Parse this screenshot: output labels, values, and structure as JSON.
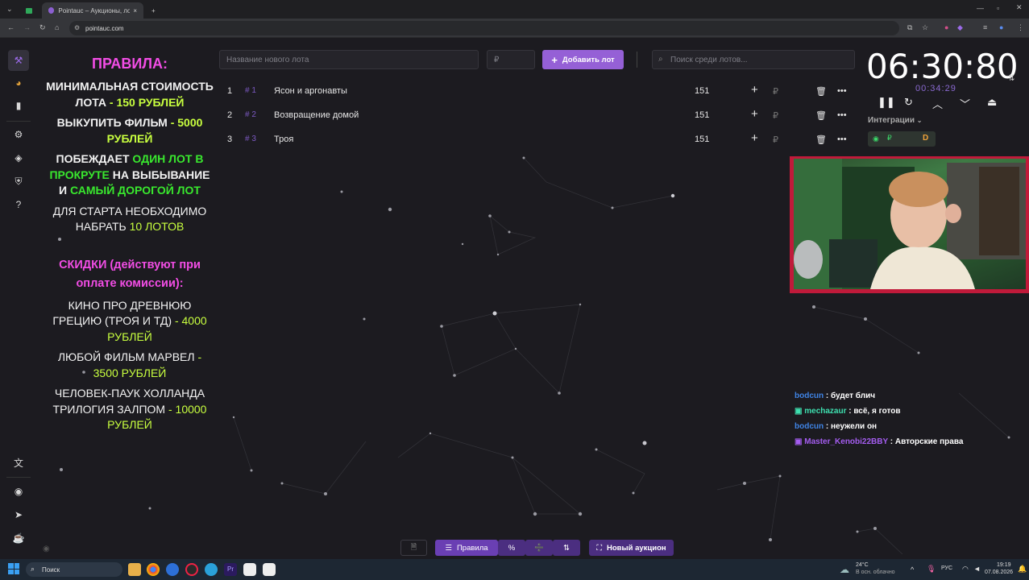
{
  "browser": {
    "tab_title": "Pointauc – Аукционы, лотере",
    "url": "pointauc.com"
  },
  "rules": {
    "title": "ПРАВИЛА:",
    "min_cost_label": "МИНИМАЛЬНАЯ СТОИМОСТЬ ЛОТА",
    "min_cost_value": "- 150 РУБЛЕЙ",
    "buyout_label": "ВЫКУПИТЬ ФИЛЬМ",
    "buyout_value": "- 5000 РУБЛЕЙ",
    "wins_prefix": "ПОБЕЖДАЕТ",
    "wins_one": "ОДИН ЛОТ В ПРОКРУТЕ",
    "wins_mid": "НА ВЫБЫВАНИЕ И",
    "wins_expensive": "САМЫЙ ДОРОГОЙ ЛОТ",
    "start_label": "ДЛЯ СТАРТА НЕОБХОДИМО НАБРАТЬ",
    "start_value": "10 ЛОТОВ",
    "discounts_title": "СКИДКИ (действуют при оплате комиссии):",
    "d1_label": "КИНО ПРО ДРЕВНЮЮ ГРЕЦИЮ (ТРОЯ И ТД)",
    "d1_value": "- 4000 РУБЛЕЙ",
    "d2_label": "ЛЮБОЙ ФИЛЬМ МАРВЕЛ",
    "d2_value": "- 3500 РУБЛЕЙ",
    "d3_label": "ЧЕЛОВЕК-ПАУК ХОЛЛАНДА ТРИЛОГИЯ ЗАЛПОМ",
    "d3_value": "- 10000 РУБЛЕЙ"
  },
  "controls": {
    "new_lot_placeholder": "Название нового лота",
    "amount_placeholder": "₽",
    "add_button": "Добавить лот",
    "search_placeholder": "Поиск среди лотов..."
  },
  "lots": [
    {
      "num": "1",
      "hash": "# 1",
      "name": "Ясон и аргонавты",
      "amount": "151"
    },
    {
      "num": "2",
      "hash": "# 2",
      "name": "Возвращение домой",
      "amount": "151"
    },
    {
      "num": "3",
      "hash": "# 3",
      "name": "Троя",
      "amount": "151"
    }
  ],
  "timer": {
    "main": "06:30:80",
    "elapsed": "00:34:29",
    "integrations_label": "Интеграции"
  },
  "chat": [
    {
      "user": "bodcun",
      "color": "#3f84e5",
      "text": " : будет блич"
    },
    {
      "user": "mechazaur",
      "color": "#3ee0b0",
      "text": " : всё, я готов"
    },
    {
      "user": "bodcun",
      "color": "#3f84e5",
      "text": " : неужели он"
    },
    {
      "user": "Master_Kenobi22BBY",
      "color": "#a45df0",
      "text": " : Авторские права"
    }
  ],
  "bottom_bar": {
    "rules_button": "Правила",
    "percent_button": "%",
    "new_auction_button": "Новый аукцион"
  },
  "taskbar": {
    "search_label": "Поиск",
    "weather_temp": "24°C",
    "weather_desc": "В осн. облачно",
    "lang": "РУС",
    "time": "19:19",
    "date": "07.08.2026"
  },
  "colors": {
    "accent": "#9560d6",
    "rules_pink": "#f24de5",
    "rules_lime": "#c8ff3f",
    "rules_green": "#39e82e",
    "webcam_border": "#c01a3a"
  }
}
